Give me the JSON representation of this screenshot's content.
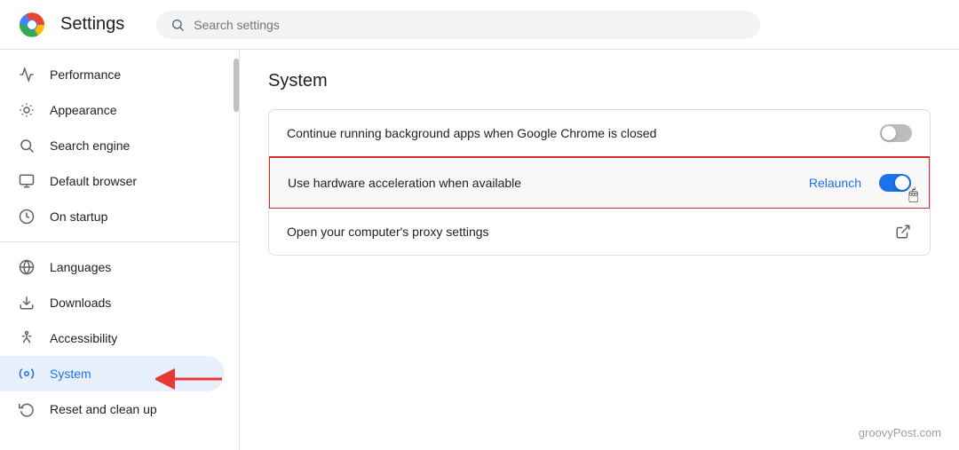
{
  "header": {
    "logo_alt": "Google Chrome Logo",
    "title": "Settings",
    "search_placeholder": "Search settings"
  },
  "sidebar": {
    "items": [
      {
        "id": "performance",
        "label": "Performance",
        "icon": "performance"
      },
      {
        "id": "appearance",
        "label": "Appearance",
        "icon": "appearance"
      },
      {
        "id": "search-engine",
        "label": "Search engine",
        "icon": "search"
      },
      {
        "id": "default-browser",
        "label": "Default browser",
        "icon": "default-browser"
      },
      {
        "id": "on-startup",
        "label": "On startup",
        "icon": "on-startup"
      },
      {
        "id": "languages",
        "label": "Languages",
        "icon": "languages"
      },
      {
        "id": "downloads",
        "label": "Downloads",
        "icon": "downloads"
      },
      {
        "id": "accessibility",
        "label": "Accessibility",
        "icon": "accessibility"
      },
      {
        "id": "system",
        "label": "System",
        "icon": "system",
        "active": true
      },
      {
        "id": "reset",
        "label": "Reset and clean up",
        "icon": "reset"
      }
    ]
  },
  "content": {
    "section_title": "System",
    "rows": [
      {
        "id": "background-apps",
        "label": "Continue running background apps when Google Chrome is closed",
        "toggle": "off",
        "highlighted": false
      },
      {
        "id": "hardware-acceleration",
        "label": "Use hardware acceleration when available",
        "toggle": "on",
        "relaunch": "Relaunch",
        "highlighted": true
      },
      {
        "id": "proxy-settings",
        "label": "Open your computer's proxy settings",
        "external_link": true,
        "highlighted": false
      }
    ]
  },
  "watermark": "groovyPost.com"
}
